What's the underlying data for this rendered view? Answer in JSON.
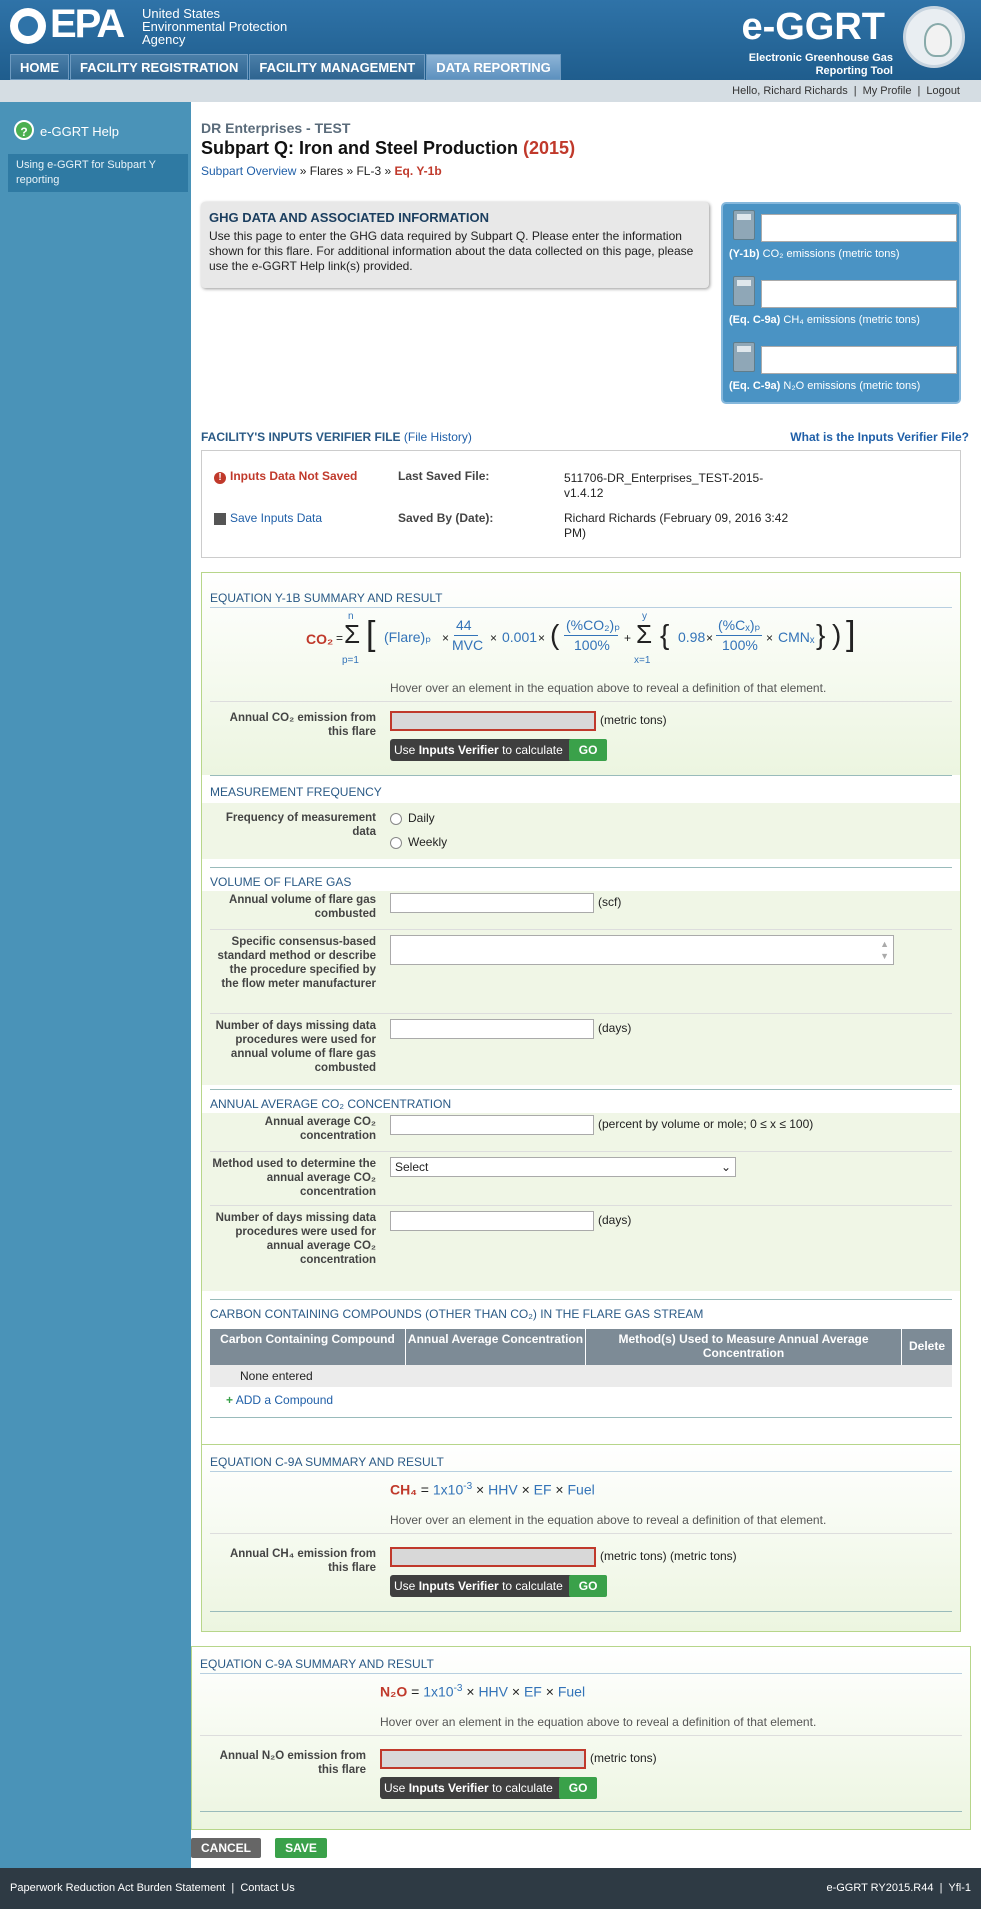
{
  "header": {
    "epa_short": "EPA",
    "epa_full": "United States Environmental Protection Agency",
    "app_name": "e-GGRT",
    "app_full": "Electronic Greenhouse Gas Reporting Tool",
    "nav": [
      "HOME",
      "FACILITY REGISTRATION",
      "FACILITY MANAGEMENT",
      "DATA REPORTING"
    ],
    "active_nav": "DATA REPORTING"
  },
  "userbar": {
    "greeting": "Hello, Richard Richards",
    "my_profile": "My Profile",
    "logout": "Logout",
    "sep": "|"
  },
  "sidebar": {
    "help": "e-GGRT Help",
    "item": "Using e-GGRT for Subpart Y reporting"
  },
  "page": {
    "facility": "DR Enterprises - TEST",
    "title": "Subpart Q: Iron and Steel Production",
    "year": "(2015)",
    "breadcrumb": {
      "overview": "Subpart Overview",
      "sep": "»",
      "flares": "Flares",
      "fl": "FL-3",
      "eq": "Eq. Y-1b"
    }
  },
  "info": {
    "title": "GHG DATA AND ASSOCIATED INFORMATION",
    "text": "Use this page to enter the GHG data required by Subpart Q. Please enter the information shown for this flare. For additional information about the data collected on this page, please use the e-GGRT Help link(s) provided."
  },
  "emissions_box": [
    {
      "eq": "(Y-1b)",
      "label": "CO₂ emissions (metric tons)",
      "value": ""
    },
    {
      "eq": "(Eq. C-9a)",
      "label": "CH₄ emissions (metric tons)",
      "value": ""
    },
    {
      "eq": "(Eq. C-9a)",
      "label": "N₂O emissions (metric tons)",
      "value": ""
    }
  ],
  "verifier": {
    "title": "FACILITY'S INPUTS VERIFIER FILE",
    "history": "(File History)",
    "what": "What is the Inputs Verifier File?",
    "not_saved": "Inputs Data Not Saved",
    "save": "Save Inputs Data",
    "last_saved_label": "Last Saved File:",
    "last_saved_value": "511706-DR_Enterprises_TEST-2015-v1.4.12",
    "saved_by_label": "Saved By (Date):",
    "saved_by_value": "Richard Richards (February 09, 2016 3:42 PM)"
  },
  "eq_y1b": {
    "heading": "EQUATION Y-1b SUMMARY AND RESULT",
    "hint": "Hover over an element in the equation above to reveal a definition of that element.",
    "label": "Annual CO₂ emission from this flare",
    "unit": "(metric tons)",
    "btn_pre": "Use",
    "btn_bold": "Inputs Verifier",
    "btn_post": "to calculate",
    "go": "GO"
  },
  "eq_text": {
    "co2": "CO₂",
    "eq": "=",
    "sum": "Σ",
    "n": "n",
    "p1": "p=1",
    "flare": "(Flare)ₚ",
    "x": "×",
    "44": "44",
    "mvc": "MVC",
    "c001": "0.001",
    "pco2": "(%CO₂)ₚ",
    "pct": "100%",
    "plus": "+",
    "y": "y",
    "x1": "x=1",
    "c098": "0.98",
    "pcx": "(%Cₓ)ₚ",
    "cmn": "CMNₓ"
  },
  "freq": {
    "heading": "MEASUREMENT FREQUENCY",
    "label": "Frequency of measurement data",
    "opt1": "Daily",
    "opt2": "Weekly"
  },
  "volume": {
    "heading": "VOLUME OF FLARE GAS",
    "vol_label": "Annual volume of flare gas combusted",
    "vol_unit": "(scf)",
    "method_label": "Specific consensus-based standard method or describe the procedure specified by the flow meter manufacturer",
    "days_label": "Number of days missing data procedures were used for annual volume of flare gas combusted",
    "days_unit": "(days)"
  },
  "co2conc": {
    "heading": "ANNUAL AVERAGE CO₂ CONCENTRATION",
    "avg_label": "Annual average CO₂ concentration",
    "avg_unit": "(percent by volume or mole; 0 ≤ x ≤ 100)",
    "method_label": "Method used to determine the annual average CO₂ concentration",
    "select": "Select",
    "days_label": "Number of days missing data procedures were used for annual average CO₂ concentration",
    "days_unit": "(days)"
  },
  "compounds": {
    "heading": "CARBON CONTAINING COMPOUNDS (OTHER THAN CO₂) IN THE FLARE GAS STREAM",
    "columns": [
      "Carbon Containing Compound",
      "Annual Average Concentration",
      "Method(s) Used to Measure Annual Average Concentration",
      "Delete"
    ],
    "none": "None entered",
    "add": "ADD a Compound"
  },
  "eq_ch4": {
    "heading": "EQUATION C-9a SUMMARY AND RESULT",
    "lhs": "CH₄",
    "eq": "=",
    "coef": "1x10",
    "exp": "-3",
    "hhv": "HHV",
    "ef": "EF",
    "fuel": "Fuel",
    "times": "×",
    "hint": "Hover over an element in the equation above to reveal a definition of that element.",
    "label": "Annual CH₄ emission from this flare",
    "unit": "(metric tons) (metric tons)",
    "btn_pre": "Use",
    "btn_bold": "Inputs Verifier",
    "btn_post": "to calculate",
    "go": "GO"
  },
  "eq_n2o": {
    "heading": "EQUATION C-9a SUMMARY AND RESULT",
    "lhs": "N₂O",
    "eq": "=",
    "coef": "1x10",
    "exp": "-3",
    "hhv": "HHV",
    "ef": "EF",
    "fuel": "Fuel",
    "times": "×",
    "hint": "Hover over an element in the equation above to reveal a definition of that element.",
    "label": "Annual N₂O emission from this flare",
    "unit": "(metric tons)",
    "btn_pre": "Use",
    "btn_bold": "Inputs Verifier",
    "btn_post": "to calculate",
    "go": "GO"
  },
  "actions": {
    "cancel": "CANCEL",
    "save": "SAVE"
  },
  "footer": {
    "paperwork": "Paperwork Reduction Act Burden Statement",
    "contact": "Contact Us",
    "sep": "|",
    "version": "e-GGRT RY2015.R44",
    "page": "Yfl-1"
  }
}
